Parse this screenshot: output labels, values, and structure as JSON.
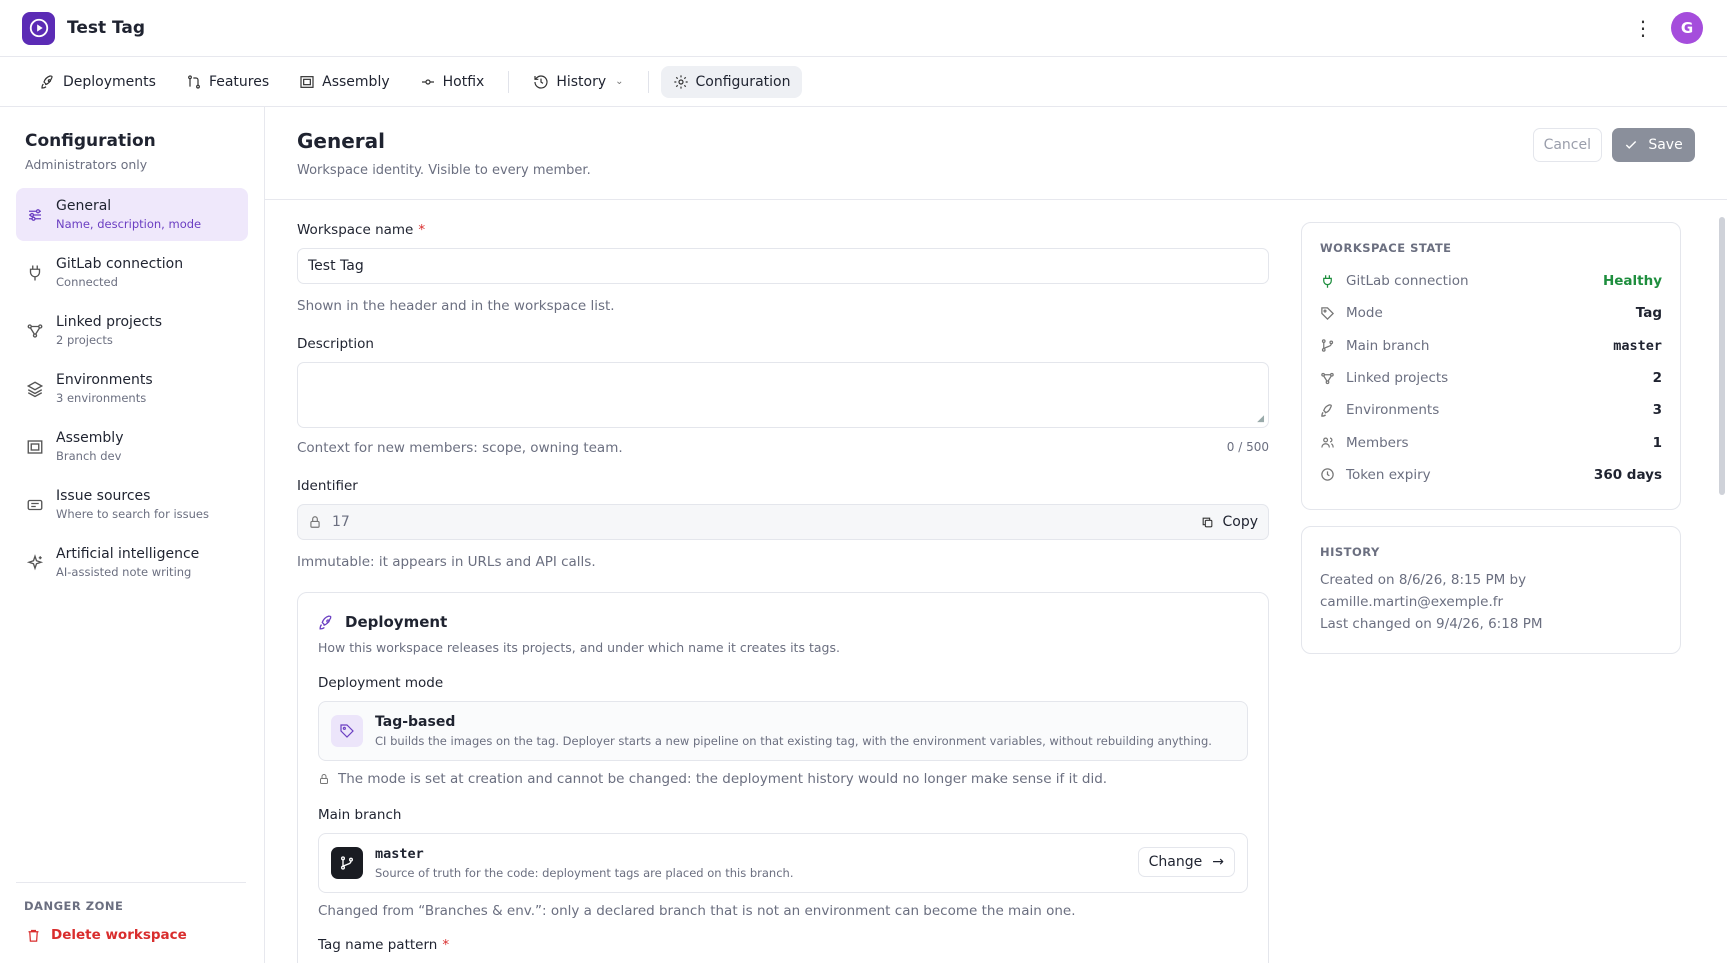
{
  "app": {
    "title": "Test Tag",
    "avatar_initial": "G"
  },
  "tabs": [
    {
      "label": "Deployments",
      "icon": "rocket-icon"
    },
    {
      "label": "Features",
      "icon": "merge-icon"
    },
    {
      "label": "Assembly",
      "icon": "frame-icon"
    },
    {
      "label": "Hotfix",
      "icon": "commit-icon"
    },
    {
      "label": "History",
      "icon": "history-icon"
    },
    {
      "label": "Configuration",
      "icon": "gear-icon"
    }
  ],
  "sidebar": {
    "title": "Configuration",
    "subtitle": "Administrators only",
    "items": [
      {
        "label": "General",
        "desc": "Name, description, mode"
      },
      {
        "label": "GitLab connection",
        "desc": "Connected"
      },
      {
        "label": "Linked projects",
        "desc": "2 projects"
      },
      {
        "label": "Environments",
        "desc": "3 environments"
      },
      {
        "label": "Assembly",
        "desc": "Branch dev"
      },
      {
        "label": "Issue sources",
        "desc": "Where to search for issues"
      },
      {
        "label": "Artificial intelligence",
        "desc": "AI-assisted note writing"
      }
    ],
    "danger_title": "DANGER ZONE",
    "delete_label": "Delete workspace"
  },
  "page": {
    "title": "General",
    "subtitle": "Workspace identity. Visible to every member.",
    "cancel": "Cancel",
    "save": "Save"
  },
  "form": {
    "name_label": "Workspace name",
    "required_mark": "*",
    "name_value": "Test Tag",
    "name_help": "Shown in the header and in the workspace list.",
    "desc_label": "Description",
    "desc_help": "Context for new members: scope, owning team.",
    "desc_counter": "0 / 500",
    "id_label": "Identifier",
    "id_value": "17",
    "copy": "Copy",
    "id_help": "Immutable: it appears in URLs and API calls."
  },
  "deployment": {
    "title": "Deployment",
    "subtitle": "How this workspace releases its projects, and under which name it creates its tags.",
    "mode_label": "Deployment mode",
    "mode_name": "Tag-based",
    "mode_desc": "CI builds the images on the tag. Deployer starts a new pipeline on that existing tag, with the environment variables, without rebuilding anything.",
    "mode_lock_note": "The mode is set at creation and cannot be changed: the deployment history would no longer make sense if it did.",
    "branch_label": "Main branch",
    "branch_name": "master",
    "branch_desc": "Source of truth for the code: deployment tags are placed on this branch.",
    "change": "Change",
    "branch_note": "Changed from “Branches & env.”: only a declared branch that is not an environment can become the main one.",
    "tag_pattern_label": "Tag name pattern"
  },
  "state": {
    "title": "WORKSPACE STATE",
    "rows": [
      {
        "label": "GitLab connection",
        "value": "Healthy"
      },
      {
        "label": "Mode",
        "value": "Tag"
      },
      {
        "label": "Main branch",
        "value": "master"
      },
      {
        "label": "Linked projects",
        "value": "2"
      },
      {
        "label": "Environments",
        "value": "3"
      },
      {
        "label": "Members",
        "value": "1"
      },
      {
        "label": "Token expiry",
        "value": "360 days"
      }
    ]
  },
  "history": {
    "title": "HISTORY",
    "line1": "Created on 8/6/26, 8:15 PM by",
    "line2": "camille.martin@exemple.fr",
    "line3": "Last changed on 9/4/26, 6:18 PM"
  }
}
